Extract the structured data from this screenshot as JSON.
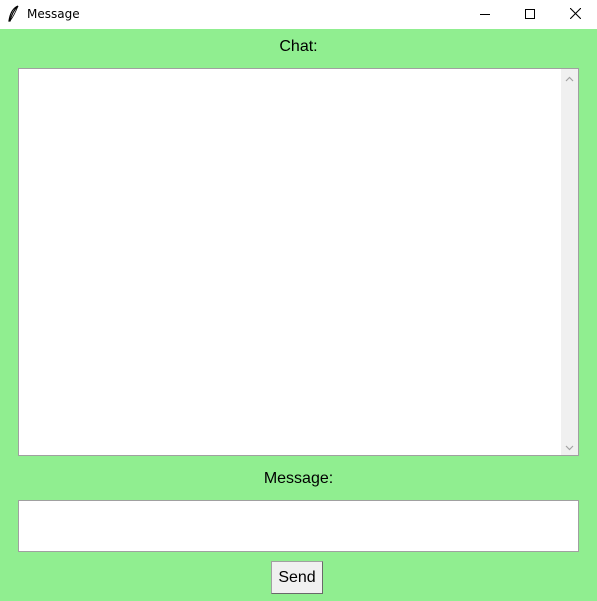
{
  "window": {
    "title": "Message",
    "icon": "feather-icon"
  },
  "titlebar_buttons": {
    "minimize_icon": "minimize-icon",
    "maximize_icon": "maximize-icon",
    "close_icon": "close-icon"
  },
  "chat": {
    "label": "Chat:",
    "content": ""
  },
  "message": {
    "label": "Message:",
    "value": ""
  },
  "send_button": {
    "label": "Send"
  },
  "colors": {
    "background": "#90ee90",
    "titlebar": "#ffffff",
    "field_background": "#ffffff",
    "button_face": "#f0f0f0",
    "border": "#a0a0a0"
  }
}
